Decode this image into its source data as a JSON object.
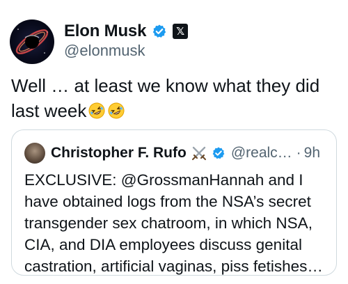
{
  "post": {
    "author_name": "Elon Musk",
    "author_handle": "@elonmusk",
    "text": "Well … at least we know what they did last week",
    "emojis": [
      "rolling-on-floor-laughing",
      "rolling-on-floor-laughing"
    ]
  },
  "quoted_post": {
    "author_name": "Christopher F. Rufo",
    "author_handle": "@realc…",
    "separator": "·",
    "time": "9h",
    "text": "EXCLUSIVE: @GrossmanHannah and I have obtained logs from the NSA’s secret transgender sex chatroom, in which NSA, CIA, and DIA employees discuss genital castration, artificial vaginas, piss fetishes…"
  },
  "icons": {
    "verified_badge": "verified-badge-icon",
    "affiliation": "x-logo-icon",
    "crossed_swords": "crossed-swords-icon"
  },
  "colors": {
    "text_primary": "#0f1419",
    "text_secondary": "#536471",
    "verified_blue": "#1d9bf0",
    "border": "#cfd9de"
  }
}
